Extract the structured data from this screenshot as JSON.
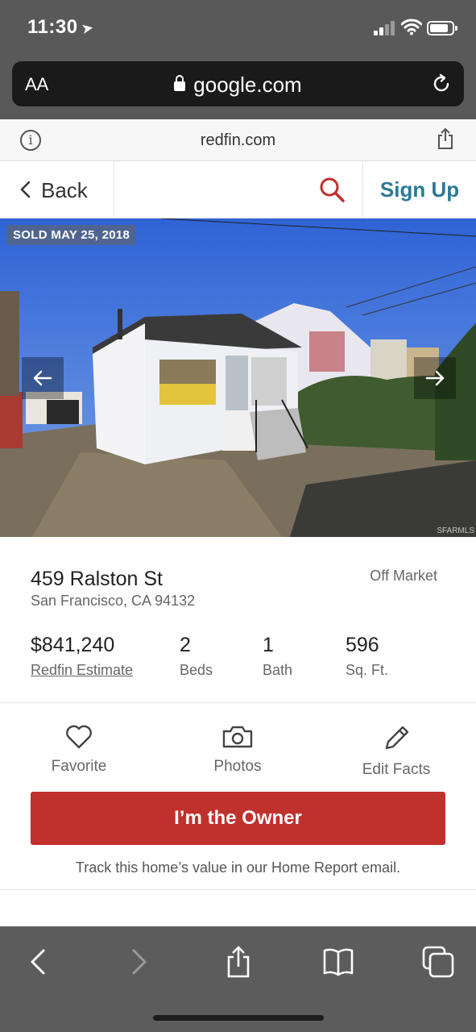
{
  "status_bar": {
    "time": "11:30",
    "location_glyph": "➤"
  },
  "browser": {
    "text_size_label": "AA",
    "domain": "google.com",
    "site": "redfin.com"
  },
  "header": {
    "back_label": "Back",
    "signup_label": "Sign Up"
  },
  "photo": {
    "badge": "SOLD MAY 25, 2018",
    "watermark": "SFARMLS"
  },
  "listing": {
    "address_line1": "459 Ralston St",
    "address_line2": "San Francisco, CA 94132",
    "status": "Off Market",
    "stats": [
      {
        "value": "$841,240",
        "label": "Redfin Estimate"
      },
      {
        "value": "2",
        "label": "Beds"
      },
      {
        "value": "1",
        "label": "Bath"
      },
      {
        "value": "596",
        "label": "Sq. Ft."
      }
    ]
  },
  "actions": {
    "favorite": "Favorite",
    "photos": "Photos",
    "edit_facts": "Edit Facts",
    "owner_button": "I’m the Owner",
    "track_text": "Track this home’s value in our Home Report email."
  },
  "colors": {
    "brand_red": "#c0302d",
    "signup_blue": "#2a7a96",
    "search_red": "#c0302d"
  }
}
